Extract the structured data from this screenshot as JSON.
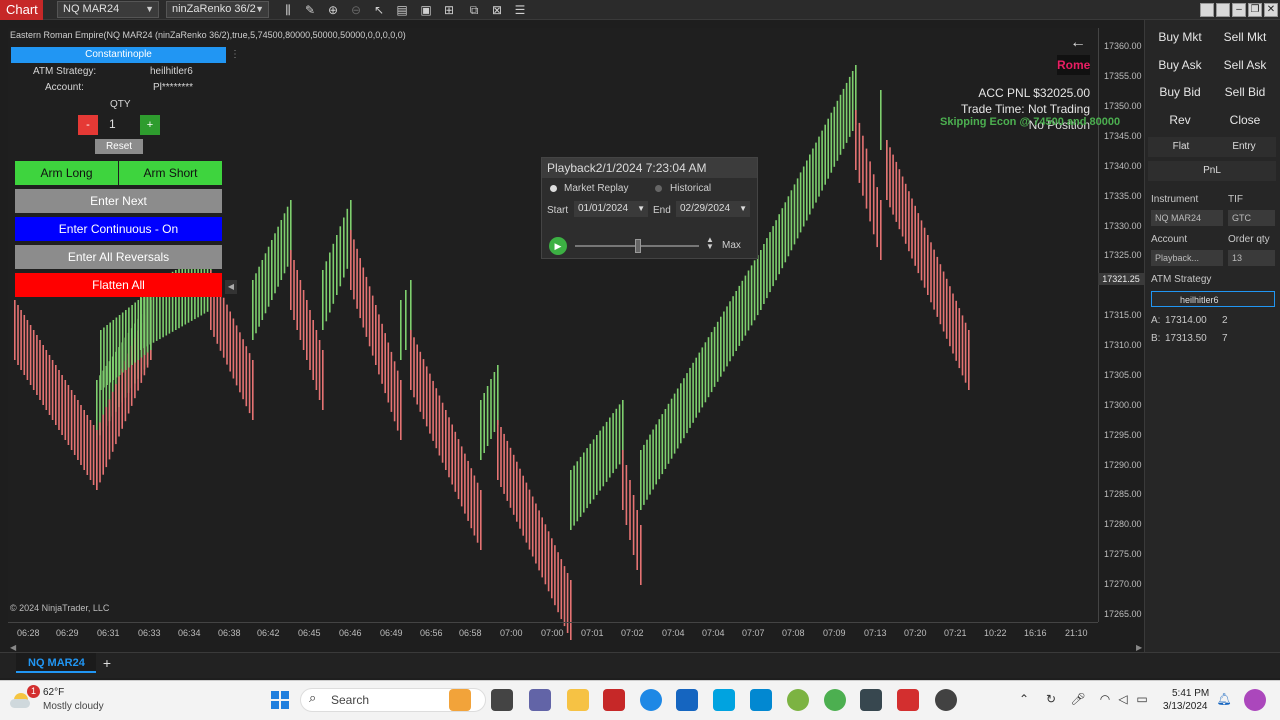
{
  "app": {
    "tag": "Chart"
  },
  "toolbar": {
    "instrument_dd": "NQ MAR24",
    "bartype_dd": "ninZaRenko 36/2",
    "icons": [
      "bars-icon",
      "pencil-icon",
      "zoom-in-icon",
      "zoom-out-icon",
      "pointer-icon",
      "properties-icon",
      "template-icon",
      "strategies-icon",
      "indicators-icon",
      "list-icon"
    ]
  },
  "chart": {
    "title": "Eastern Roman Empire(NQ MAR24 (ninZaRenko 36/2),true,5,74500,80000,50000,50000,0,0,0,0,0)",
    "copyright": "© 2024 NinjaTrader, LLC",
    "current_price": "17321.25",
    "y_ticks": [
      "17360.00",
      "17355.00",
      "17350.00",
      "17345.00",
      "17340.00",
      "17335.00",
      "17330.00",
      "17325.00",
      "17315.00",
      "17310.00",
      "17305.00",
      "17300.00",
      "17295.00",
      "17290.00",
      "17285.00",
      "17280.00",
      "17275.00",
      "17270.00",
      "17265.00"
    ],
    "x_ticks": [
      "06:28",
      "06:29",
      "06:31",
      "06:33",
      "06:34",
      "06:38",
      "06:42",
      "06:45",
      "06:46",
      "06:49",
      "06:56",
      "06:58",
      "07:00",
      "07:00",
      "07:01",
      "07:02",
      "07:04",
      "07:04",
      "07:07",
      "07:08",
      "07:09",
      "07:13",
      "07:20",
      "07:21",
      "10:22",
      "16:16",
      "21:10"
    ]
  },
  "strategy_panel": {
    "header": "Constantinople",
    "atm_label": "ATM Strategy:",
    "atm_value": "heilhitler6",
    "account_label": "Account:",
    "account_value": "Pl********",
    "qty_label": "QTY",
    "qty_minus": "-",
    "qty_value": "1",
    "qty_plus": "+",
    "reset": "Reset",
    "arm_long": "Arm Long",
    "arm_short": "Arm Short",
    "enter_next": "Enter Next",
    "enter_continuous": "Enter Continuous - On",
    "enter_all_reversals": "Enter All Reversals",
    "flatten_all": "Flatten All"
  },
  "overlay": {
    "badge": "Rome",
    "acc_pnl": "ACC PNL $32025.00",
    "trade_time": "Trade Time: Not Trading",
    "econ": "Skipping Econ @ 74500 and 80000",
    "position": "No Position"
  },
  "playback": {
    "title": "Playback2/1/2024 7:23:04 AM",
    "market_replay": "Market Replay",
    "historical": "Historical",
    "start_label": "Start",
    "start_date": "01/01/2024",
    "end_label": "End",
    "end_date": "02/29/2024",
    "speed_label": "Max",
    "slider_fraction": 0.52
  },
  "trade_panel": {
    "buy_mkt": "Buy Mkt",
    "sell_mkt": "Sell Mkt",
    "buy_ask": "Buy Ask",
    "sell_ask": "Sell Ask",
    "buy_bid": "Buy Bid",
    "sell_bid": "Sell Bid",
    "rev": "Rev",
    "close": "Close",
    "tab_flat": "Flat",
    "tab_entry": "Entry",
    "tab_pnl": "PnL",
    "instrument_label": "Instrument",
    "instrument_value": "NQ MAR24",
    "tif_label": "TIF",
    "tif_value": "GTC",
    "account_label": "Account",
    "account_value": "Playback...",
    "orderqty_label": "Order qty",
    "orderqty_value": "13",
    "atm_label": "ATM Strategy",
    "atm_value": "heilhitler6",
    "ask_label": "A:",
    "ask_price": "17314.00",
    "ask_size": "2",
    "bid_label": "B:",
    "bid_price": "17313.50",
    "bid_size": "7"
  },
  "tabs": {
    "active": "NQ MAR24",
    "add": "+"
  },
  "taskbar": {
    "weather_badge": "1",
    "temp": "62°F",
    "weather": "Mostly cloudy",
    "search_placeholder": "Search",
    "time": "5:41 PM",
    "date": "3/13/2024"
  },
  "colors": {
    "up": "#7ecf6e",
    "down": "#e57373",
    "accent": "#2196f3",
    "arm_green": "#3ed43e",
    "enter_blue": "#0000ff",
    "flatten_red": "#ff0000"
  }
}
